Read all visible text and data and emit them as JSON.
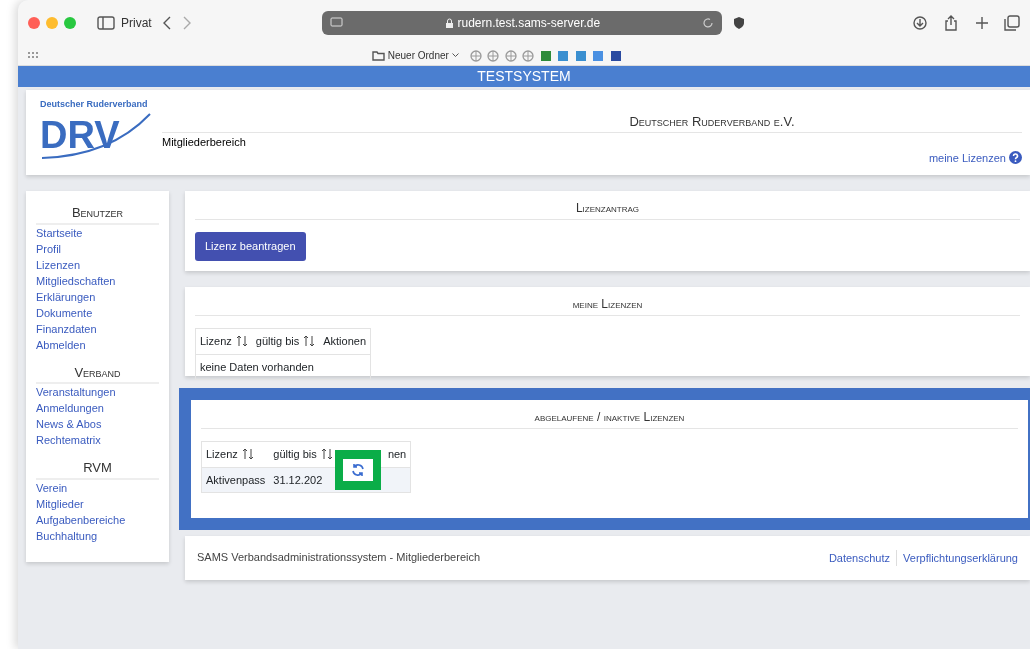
{
  "browser": {
    "private_label": "Privat",
    "url": "rudern.test.sams-server.de",
    "bookmark_folder": "Neuer Ordner"
  },
  "banner": "TESTSYSTEM",
  "header": {
    "logo_caption": "Deutscher Ruderverband",
    "logo_letters": "DRV",
    "subtitle": "Mitgliederbereich",
    "title": "Deutscher Ruderverband e.V.",
    "help_link": "meine Lizenzen"
  },
  "sidebar": {
    "sections": [
      {
        "heading": "Benutzer",
        "items": [
          {
            "label": "Startseite"
          },
          {
            "label": "Profil"
          },
          {
            "label": "Lizenzen"
          },
          {
            "label": "Mitgliedschaften"
          },
          {
            "label": "Erklärungen"
          },
          {
            "label": "Dokumente"
          },
          {
            "label": "Finanzdaten"
          },
          {
            "label": "Abmelden"
          }
        ]
      },
      {
        "heading": "Verband",
        "items": [
          {
            "label": "Veranstaltungen"
          },
          {
            "label": "Anmeldungen"
          },
          {
            "label": "News & Abos"
          },
          {
            "label": "Rechtematrix"
          }
        ]
      },
      {
        "heading": "RVM",
        "items": [
          {
            "label": "Verein"
          },
          {
            "label": "Mitglieder"
          },
          {
            "label": "Aufgabenbereiche"
          },
          {
            "label": "Buchhaltung"
          }
        ]
      }
    ]
  },
  "license_request": {
    "title": "Lizenzantrag",
    "button": "Lizenz beantragen"
  },
  "my_licenses": {
    "title": "meine Lizenzen",
    "highlighted": false,
    "columns": [
      {
        "label": "Lizenz",
        "sortable": true
      },
      {
        "label": "gültig bis",
        "sortable": true
      },
      {
        "label": "Aktionen",
        "sortable": false
      }
    ],
    "empty_text": "keine Daten vorhanden"
  },
  "expired_licenses": {
    "title": "abgelaufene / inaktive Lizenzen",
    "highlighted": true,
    "columns": [
      {
        "label": "Lizenz",
        "sortable": true
      },
      {
        "label": "gültig bis",
        "sortable": true
      },
      {
        "label": "nen",
        "sortable": false
      }
    ],
    "rows": [
      {
        "license": "Aktivenpass",
        "valid_until": "31.12.202"
      }
    ]
  },
  "footer": {
    "text": "SAMS Verbandsadministrationssystem - Mitgliederbereich",
    "links": [
      "Datenschutz",
      "Verpflichtungserklärung"
    ]
  }
}
